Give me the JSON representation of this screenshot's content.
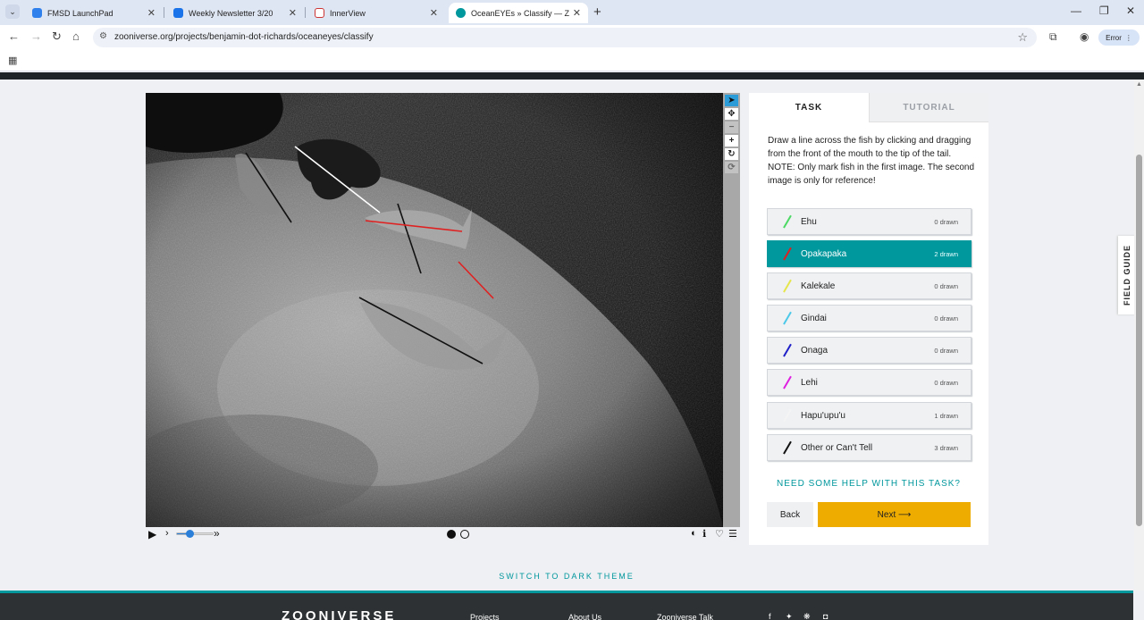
{
  "browser": {
    "tabs": [
      {
        "label": "FMSD LaunchPad",
        "color": "#2f80ed"
      },
      {
        "label": "Weekly Newsletter 3/20",
        "color": "#1a73e8"
      },
      {
        "label": "InnerView",
        "color": "#e8e8f0"
      },
      {
        "label": "OceanEYEs » Classify — Zooniv",
        "color": "#00979d"
      }
    ],
    "url": "zooniverse.org/projects/benjamin-dot-richards/oceaneyes/classify",
    "profile_label": "Error"
  },
  "tools": [
    "pointer-icon",
    "move-icon",
    "zoom-out-icon",
    "zoom-in-icon",
    "rotate-icon",
    "reset-icon"
  ],
  "task_panel": {
    "tab_task": "TASK",
    "tab_tutorial": "TUTORIAL",
    "instruction_1": "Draw a line across the fish by clicking and dragging from the front of the mouth to the tip of the tail.",
    "instruction_2": "NOTE: Only mark fish in the first image. The second image is only for reference!",
    "options": [
      {
        "label": "Ehu",
        "count": "0 drawn",
        "color": "#4cd964"
      },
      {
        "label": "Opakapaka",
        "count": "2 drawn",
        "color": "#e02020"
      },
      {
        "label": "Kalekale",
        "count": "0 drawn",
        "color": "#e6e64c"
      },
      {
        "label": "Gindai",
        "count": "0 drawn",
        "color": "#4cc8e8"
      },
      {
        "label": "Onaga",
        "count": "0 drawn",
        "color": "#2020c8"
      },
      {
        "label": "Lehi",
        "count": "0 drawn",
        "color": "#e020e0"
      },
      {
        "label": "Hapu'upu'u",
        "count": "1 drawn",
        "color": "#f4f4f4"
      },
      {
        "label": "Other or Can't Tell",
        "count": "3 drawn",
        "color": "#111111"
      }
    ],
    "help_link": "NEED SOME HELP WITH THIS TASK?",
    "back_label": "Back",
    "next_label": "Next ⟶"
  },
  "field_guide": "FIELD GUIDE",
  "theme_toggle": "SWITCH TO DARK THEME",
  "footer": {
    "logo": "ZOONIVERSE",
    "links": [
      "Projects",
      "About Us",
      "Zooniverse Talk"
    ]
  }
}
